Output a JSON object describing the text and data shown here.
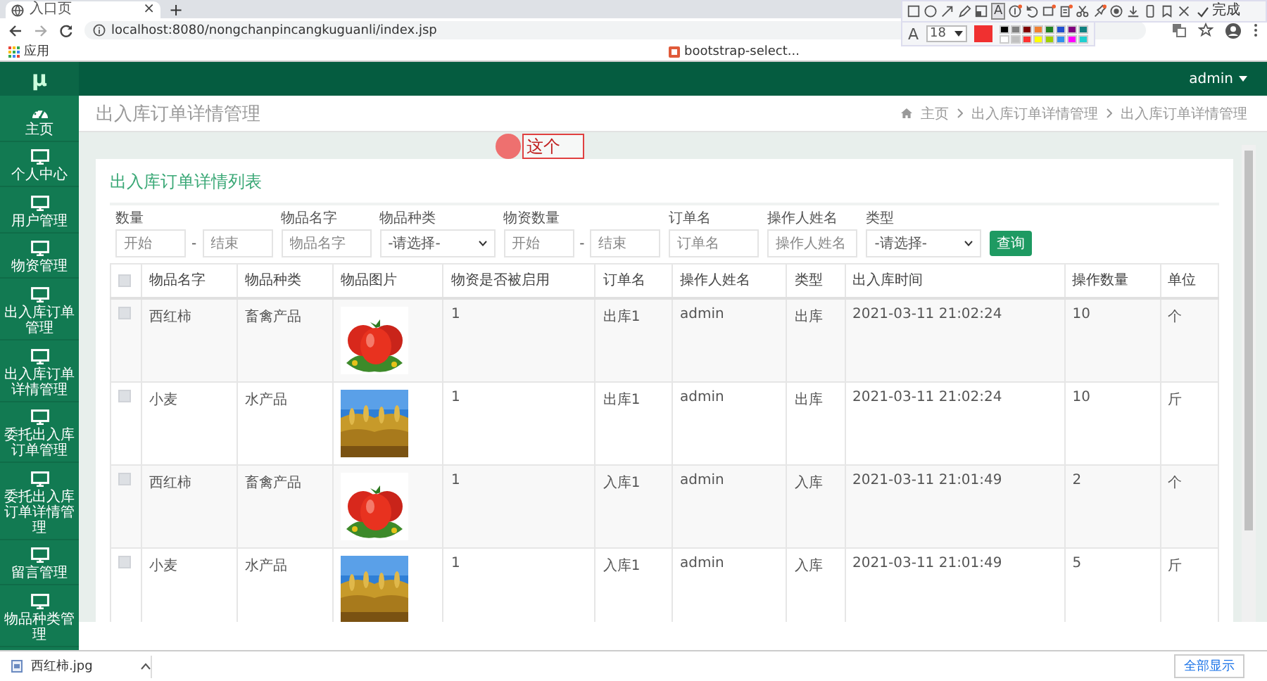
{
  "browser": {
    "tab": {
      "title": "入口页",
      "close": "×"
    },
    "new_tab": "+",
    "address": "localhost:8080/nongchanpincangkuguanli/index.jsp",
    "bookmarks": [
      {
        "label": "应用",
        "kind": "apps"
      },
      {
        "label": "bootstrap-select...",
        "kind": "site"
      }
    ]
  },
  "capture_toolbar": {
    "text_tool": "A",
    "font_label": "A",
    "font_size": "18",
    "current_swatch": {
      "color": "#f03030"
    },
    "done": "完成",
    "palette": [
      {
        "color": "#000000"
      },
      {
        "color": "#808080"
      },
      {
        "color": "#800000"
      },
      {
        "color": "#f08030"
      },
      {
        "color": "#208020"
      },
      {
        "color": "#2050d0"
      },
      {
        "color": "#800080"
      },
      {
        "color": "#108080"
      },
      {
        "color": "#ffffff"
      },
      {
        "color": "#c0c0c0"
      },
      {
        "color": "#ff3030"
      },
      {
        "color": "#ffff00"
      },
      {
        "color": "#a0d000"
      },
      {
        "color": "#3090f0"
      },
      {
        "color": "#ff00ff"
      },
      {
        "color": "#20d0d0"
      }
    ]
  },
  "app": {
    "logo": "μ",
    "user": "admin",
    "sidebar": [
      {
        "label": "主页",
        "kind": "dashboard"
      },
      {
        "label": "个人中心",
        "kind": "page"
      },
      {
        "label": "用户管理",
        "kind": "page"
      },
      {
        "label": "物资管理",
        "kind": "page"
      },
      {
        "label": "出入库订单管理",
        "kind": "page"
      },
      {
        "label": "出入库订单详情管理",
        "kind": "page"
      },
      {
        "label": "委托出入库订单管理",
        "kind": "page"
      },
      {
        "label": "委托出入库订单详情管理",
        "kind": "page"
      },
      {
        "label": "留言管理",
        "kind": "page"
      },
      {
        "label": "物品种类管理",
        "kind": "page"
      }
    ],
    "page_title": "出入库订单详情管理",
    "breadcrumb": [
      "主页",
      "出入库订单详情管理",
      "出入库订单详情管理"
    ],
    "annotation": "这个",
    "panel_title": "出入库订单详情列表",
    "filters": [
      {
        "label": "数量",
        "kind": "range",
        "placeholder_from": "开始",
        "separator": "-",
        "placeholder_to": "结束"
      },
      {
        "label": "物品名字",
        "kind": "text",
        "placeholder": "物品名字"
      },
      {
        "label": "物品种类",
        "kind": "select",
        "value": "-请选择-"
      },
      {
        "label": "物资数量",
        "kind": "range",
        "placeholder_from": "开始",
        "separator": "-",
        "placeholder_to": "结束"
      },
      {
        "label": "订单名",
        "kind": "text",
        "placeholder": "订单名"
      },
      {
        "label": "操作人姓名",
        "kind": "text",
        "placeholder": "操作人姓名"
      },
      {
        "label": "类型",
        "kind": "select",
        "value": "-请选择-"
      }
    ],
    "search_button": "查询",
    "table": {
      "header_checked": false,
      "columns": [
        "物品名字",
        "物品种类",
        "物品图片",
        "物资是否被启用",
        "订单名",
        "操作人姓名",
        "类型",
        "出入库时间",
        "操作数量",
        "单位"
      ],
      "rows": [
        {
          "checked": false,
          "cells": [
            "西红柿",
            "畜禽产品",
            {
              "kind": "picture"
            },
            "1",
            "出库1",
            "admin",
            "出库",
            "2021-03-11 21:02:24",
            "10",
            "个"
          ]
        },
        {
          "checked": false,
          "cells": [
            "小麦",
            "水产品",
            {
              "kind": "picture"
            },
            "1",
            "出库1",
            "admin",
            "出库",
            "2021-03-11 21:02:24",
            "10",
            "斤"
          ]
        },
        {
          "checked": false,
          "cells": [
            "西红柿",
            "畜禽产品",
            {
              "kind": "picture"
            },
            "1",
            "入库1",
            "admin",
            "入库",
            "2021-03-11 21:01:49",
            "2",
            "个"
          ]
        },
        {
          "checked": false,
          "cells": [
            "小麦",
            "水产品",
            {
              "kind": "picture"
            },
            "1",
            "入库1",
            "admin",
            "入库",
            "2021-03-11 21:01:49",
            "5",
            "斤"
          ]
        }
      ]
    }
  },
  "downloads": {
    "file": "西红柿.jpg",
    "show_all": "全部显示"
  }
}
